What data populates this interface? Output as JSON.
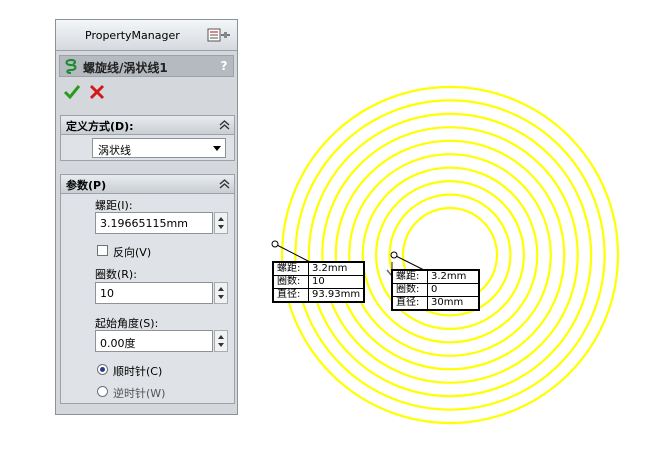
{
  "pm": {
    "header_title": "PropertyManager",
    "feature_title": "螺旋线/涡状线1",
    "help": "?"
  },
  "definition": {
    "title": "定义方式(D):",
    "selected": "涡状线"
  },
  "parameters": {
    "title": "参数(P)",
    "pitch_label": "螺距(I):",
    "pitch_value": "3.19665115mm",
    "reverse_label": "反向(V)",
    "reverse_checked": false,
    "revolutions_label": "圈数(R):",
    "revolutions_value": "10",
    "start_angle_label": "起始角度(S):",
    "start_angle_value": "0.00度",
    "clockwise_label": "顺时针(C)",
    "counterclockwise_label": "逆时针(W)",
    "direction": "clockwise"
  },
  "viewport": {
    "spiral_color": "#ffff00",
    "callout_outer": [
      {
        "key": "螺距:",
        "value": "3.2mm"
      },
      {
        "key": "圈数:",
        "value": "10"
      },
      {
        "key": "直径:",
        "value": "93.93mm"
      }
    ],
    "callout_inner": [
      {
        "key": "螺距:",
        "value": "3.2mm"
      },
      {
        "key": "圈数:",
        "value": "0"
      },
      {
        "key": "直径:",
        "value": "30mm"
      }
    ]
  }
}
